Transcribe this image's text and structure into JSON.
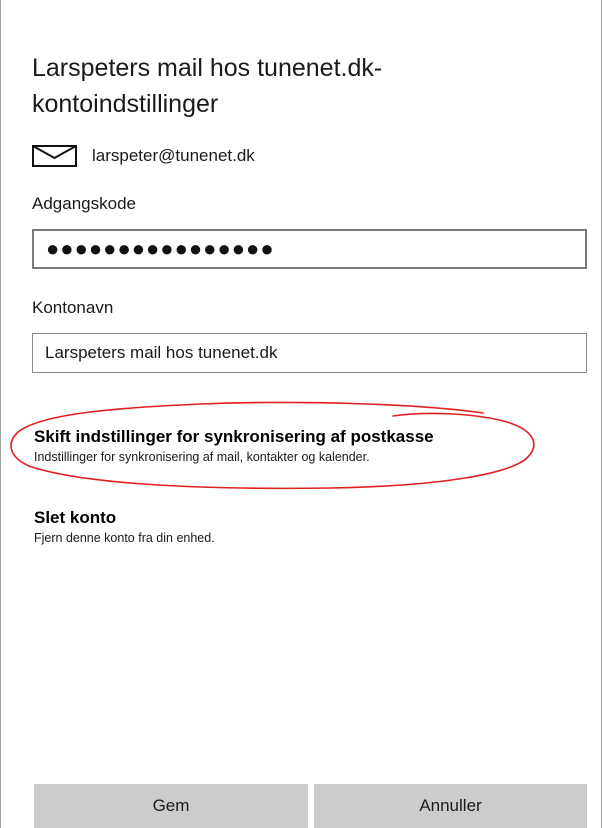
{
  "dialog": {
    "title": "Larspeters mail hos tunenet.dk-kontoindstillinger",
    "account_email": "larspeter@tunenet.dk",
    "mail_icon": "envelope-icon"
  },
  "password": {
    "label": "Adgangskode",
    "masked_value": "●●●●●●●●●●●●●●●●"
  },
  "account_name": {
    "label": "Kontonavn",
    "value": "Larspeters mail hos tunenet.dk"
  },
  "options": {
    "sync": {
      "title": "Skift indstillinger for synkronisering af postkasse",
      "description": "Indstillinger for synkronisering af mail, kontakter og kalender."
    },
    "delete": {
      "title": "Slet konto",
      "description": "Fjern denne konto fra din enhed."
    }
  },
  "buttons": {
    "save": "Gem",
    "cancel": "Annuller"
  },
  "colors": {
    "annotation": "#e02020",
    "button_bg": "#cccccc"
  }
}
